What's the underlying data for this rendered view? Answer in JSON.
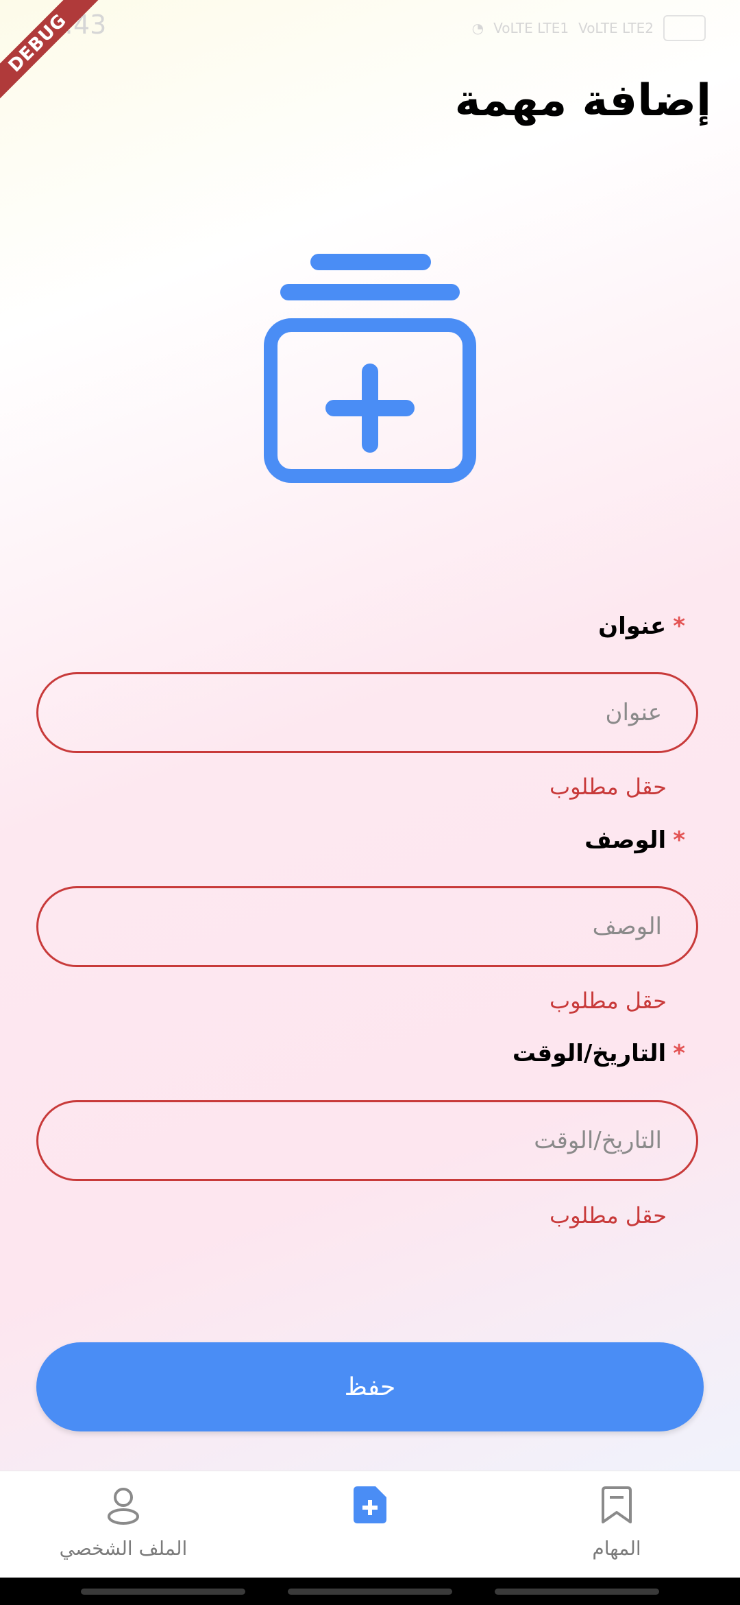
{
  "status_bar": {
    "time": "3:43",
    "network_1": "VoLTE LTE1",
    "network_2": "VoLTE LTE2"
  },
  "debug_banner": "DEBUG",
  "page_title": "إضافة مهمة",
  "hero_icon": "add-task-icon",
  "form": {
    "title": {
      "label": "عنوان",
      "required_mark": "*",
      "placeholder": "عنوان",
      "value": "",
      "error": "حقل مطلوب"
    },
    "description": {
      "label": "الوصف",
      "required_mark": "*",
      "placeholder": "الوصف",
      "value": "",
      "error": "حقل مطلوب"
    },
    "datetime": {
      "label": "التاريخ/الوقت",
      "required_mark": "*",
      "placeholder": "التاريخ/الوقت",
      "value": "",
      "error": "حقل مطلوب"
    }
  },
  "save_button": {
    "label": "حفظ"
  },
  "bottom_nav": {
    "items": [
      {
        "label": "الملف الشخصي",
        "icon": "person-icon",
        "active": false
      },
      {
        "label": "",
        "icon": "add-document-icon",
        "active": true
      },
      {
        "label": "المهام",
        "icon": "bookmark-icon",
        "active": false
      }
    ]
  },
  "colors": {
    "accent": "#4a8df5",
    "error": "#c83a3a",
    "required": "#e35353"
  }
}
